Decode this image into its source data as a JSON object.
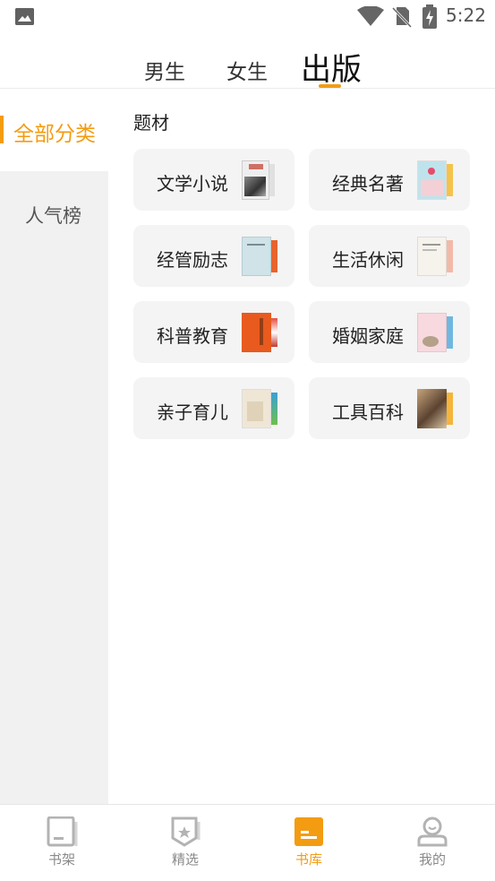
{
  "status_bar": {
    "time": "5:22"
  },
  "top_tabs": {
    "male": "男生",
    "female": "女生",
    "publish": "出版"
  },
  "sidebar": {
    "items": [
      {
        "label": "全部分类"
      },
      {
        "label": "人气榜"
      }
    ]
  },
  "section": {
    "title": "题材"
  },
  "categories": [
    {
      "label": "文学小说"
    },
    {
      "label": "经典名著"
    },
    {
      "label": "经管励志"
    },
    {
      "label": "生活休闲"
    },
    {
      "label": "科普教育"
    },
    {
      "label": "婚姻家庭"
    },
    {
      "label": "亲子育儿"
    },
    {
      "label": "工具百科"
    }
  ],
  "bottom_nav": {
    "items": [
      {
        "label": "书架"
      },
      {
        "label": "精选"
      },
      {
        "label": "书库"
      },
      {
        "label": "我的"
      }
    ]
  },
  "colors": {
    "accent": "#f39c12",
    "sidebar_bg": "#f1f1f1",
    "card_bg": "#f4f4f4"
  }
}
